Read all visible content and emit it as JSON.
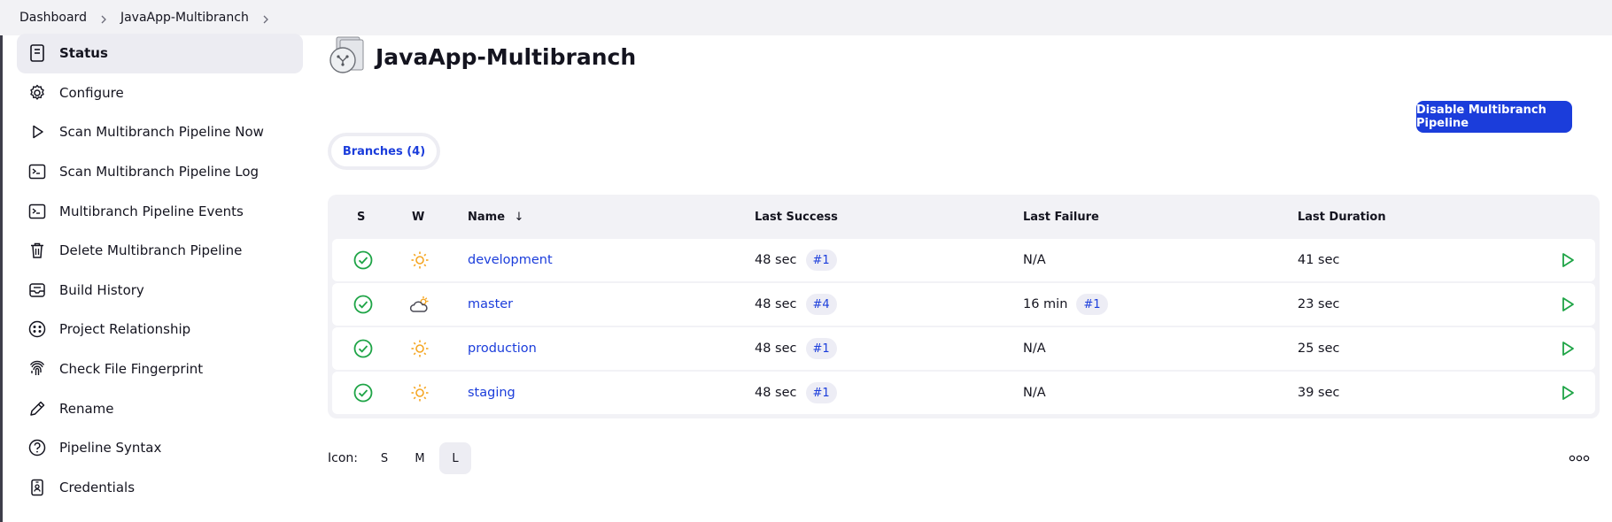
{
  "breadcrumb": {
    "items": [
      "Dashboard",
      "JavaApp-Multibranch"
    ]
  },
  "sidebar": {
    "items": [
      {
        "label": "Status",
        "icon": "status-document-icon",
        "active": true
      },
      {
        "label": "Configure",
        "icon": "gear-icon"
      },
      {
        "label": "Scan Multibranch Pipeline Now",
        "icon": "play-icon"
      },
      {
        "label": "Scan Multibranch Pipeline Log",
        "icon": "terminal-icon"
      },
      {
        "label": "Multibranch Pipeline Events",
        "icon": "terminal-icon"
      },
      {
        "label": "Delete Multibranch Pipeline",
        "icon": "trash-icon"
      },
      {
        "label": "Build History",
        "icon": "inbox-icon"
      },
      {
        "label": "Project Relationship",
        "icon": "relationship-icon"
      },
      {
        "label": "Check File Fingerprint",
        "icon": "fingerprint-icon"
      },
      {
        "label": "Rename",
        "icon": "pencil-icon"
      },
      {
        "label": "Pipeline Syntax",
        "icon": "help-circle-icon"
      },
      {
        "label": "Credentials",
        "icon": "credentials-icon"
      }
    ]
  },
  "main": {
    "title": "JavaApp-Multibranch",
    "disable_button": "Disable Multibranch Pipeline",
    "tab_label": "Branches (4)"
  },
  "table": {
    "headers": {
      "s": "S",
      "w": "W",
      "name": "Name",
      "sort_indicator": "↓",
      "last_success": "Last Success",
      "last_failure": "Last Failure",
      "last_duration": "Last Duration"
    },
    "rows": [
      {
        "name": "development",
        "weather": "sunny",
        "last_success": "48 sec",
        "success_build": "#1",
        "last_failure": "N/A",
        "failure_build": "",
        "last_duration": "41 sec"
      },
      {
        "name": "master",
        "weather": "cloudy",
        "last_success": "48 sec",
        "success_build": "#4",
        "last_failure": "16 min",
        "failure_build": "#1",
        "last_duration": "23 sec"
      },
      {
        "name": "production",
        "weather": "sunny",
        "last_success": "48 sec",
        "success_build": "#1",
        "last_failure": "N/A",
        "failure_build": "",
        "last_duration": "25 sec"
      },
      {
        "name": "staging",
        "weather": "sunny",
        "last_success": "48 sec",
        "success_build": "#1",
        "last_failure": "N/A",
        "failure_build": "",
        "last_duration": "39 sec"
      }
    ]
  },
  "icon_size": {
    "label": "Icon:",
    "options": [
      "S",
      "M",
      "L"
    ],
    "selected": "L"
  },
  "colors": {
    "accent": "#1b3ddb",
    "success": "#1ea446",
    "sun": "#f5a623"
  }
}
